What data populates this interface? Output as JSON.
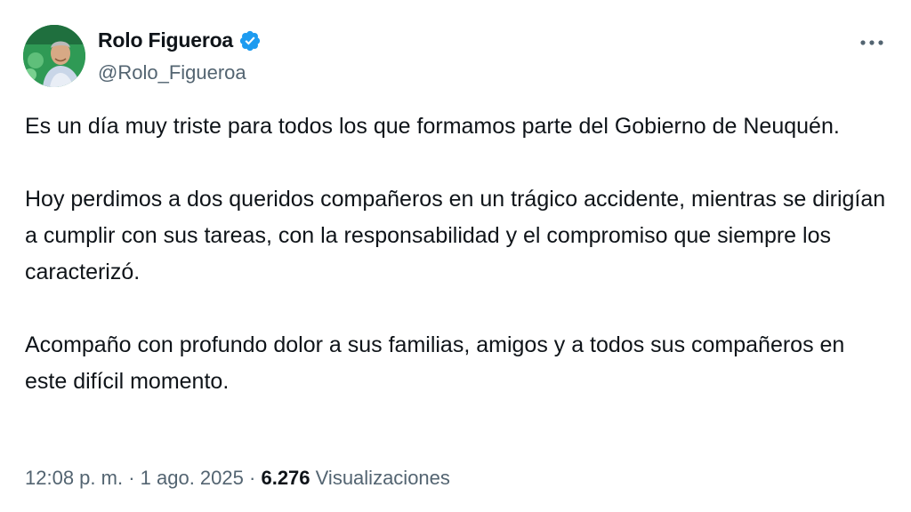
{
  "author": {
    "display_name": "Rolo Figueroa",
    "handle": "@Rolo_Figueroa",
    "verified": true,
    "verified_color": "#1d9bf0"
  },
  "tweet": {
    "paragraphs": [
      "Es un día muy triste para todos los que formamos parte del Gobierno de Neuquén.",
      "Hoy perdimos a dos queridos compañeros en un trágico accidente, mientras se dirigían a cumplir con sus tareas, con la responsabilidad y el compromiso que siempre los caracterizó.",
      "Acompaño con profundo dolor a sus familias, amigos y a todos sus compañeros en este difícil momento."
    ]
  },
  "meta": {
    "time": "12:08 p. m.",
    "separator": "·",
    "date": "1 ago. 2025",
    "views_count": "6.276",
    "views_label": "Visualizaciones"
  },
  "icons": {
    "more": "more-horizontal-icon",
    "verified": "verified-badge-icon"
  },
  "colors": {
    "text_primary": "#0f1419",
    "text_secondary": "#536471",
    "accent": "#1d9bf0"
  }
}
